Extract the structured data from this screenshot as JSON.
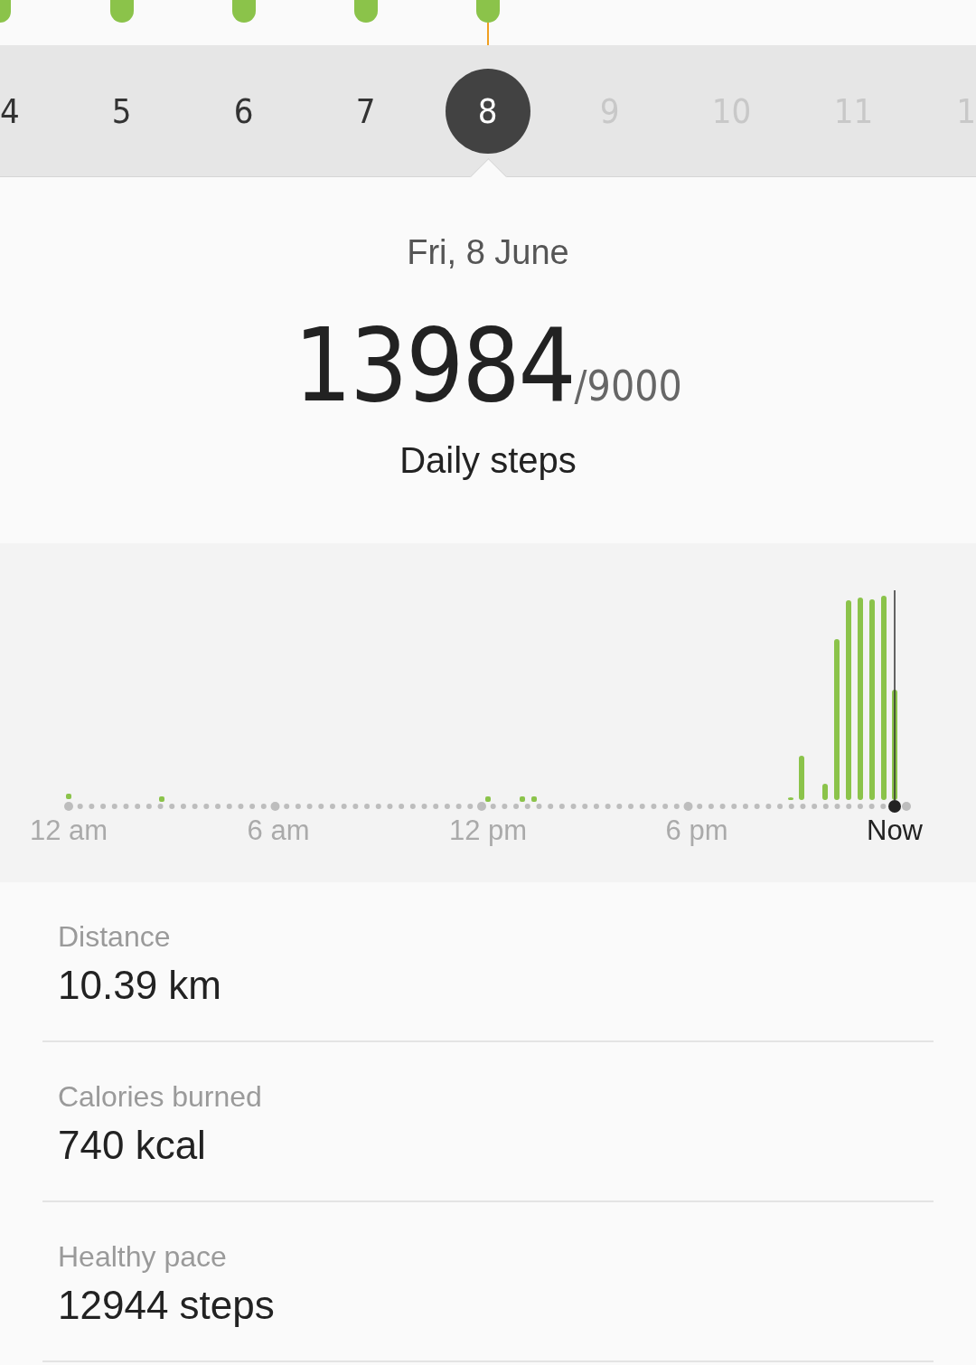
{
  "days": [
    {
      "label": "4",
      "selected": false,
      "disabled": false
    },
    {
      "label": "5",
      "selected": false,
      "disabled": false
    },
    {
      "label": "6",
      "selected": false,
      "disabled": false
    },
    {
      "label": "7",
      "selected": false,
      "disabled": false
    },
    {
      "label": "8",
      "selected": true,
      "disabled": false
    },
    {
      "label": "9",
      "selected": false,
      "disabled": true
    },
    {
      "label": "10",
      "selected": false,
      "disabled": true
    },
    {
      "label": "11",
      "selected": false,
      "disabled": true
    },
    {
      "label": "1",
      "selected": false,
      "disabled": true
    }
  ],
  "summary": {
    "date": "Fri, 8 June",
    "steps": "13984",
    "goal": "/9000",
    "caption": "Daily steps"
  },
  "chart": {
    "x_labels": [
      {
        "label": "12 am",
        "kind": "tick"
      },
      {
        "label": "6 am",
        "kind": "tick"
      },
      {
        "label": "12 pm",
        "kind": "tick"
      },
      {
        "label": "6 pm",
        "kind": "tick"
      },
      {
        "label": "Now",
        "kind": "now"
      }
    ]
  },
  "stats": [
    {
      "label": "Distance",
      "value": "10.39 km"
    },
    {
      "label": "Calories burned",
      "value": "740 kcal"
    },
    {
      "label": "Healthy pace",
      "value": "12944 steps"
    }
  ]
}
